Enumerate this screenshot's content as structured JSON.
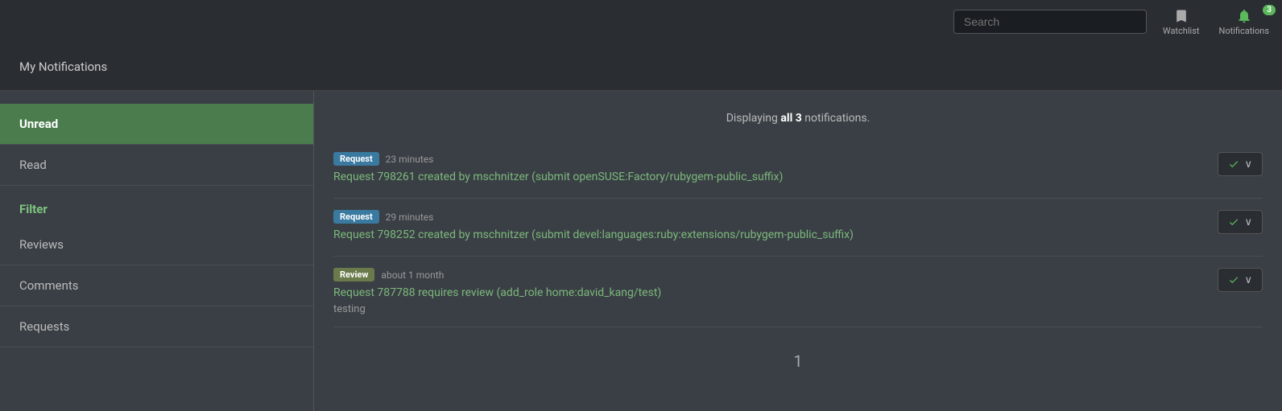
{
  "topnav": {
    "search_placeholder": "Search",
    "watchlist_label": "Watchlist",
    "notifications_label": "Notifications",
    "notifications_count": "3"
  },
  "page_header": {
    "title": "My Notifications"
  },
  "sidebar": {
    "nav_items": [
      {
        "id": "unread",
        "label": "Unread",
        "active": true
      },
      {
        "id": "read",
        "label": "Read",
        "active": false
      }
    ],
    "filter_label": "Filter",
    "filter_items": [
      {
        "id": "reviews",
        "label": "Reviews"
      },
      {
        "id": "comments",
        "label": "Comments"
      },
      {
        "id": "requests",
        "label": "Requests"
      }
    ]
  },
  "content": {
    "displaying_prefix": "Displaying ",
    "displaying_bold": "all 3",
    "displaying_suffix": " notifications.",
    "notifications": [
      {
        "id": "n1",
        "tag": "Request",
        "tag_type": "request",
        "time": "23 minutes",
        "link": "Request 798261 created by mschnitzer (submit openSUSE:Factory/rubygem-public_suffix)",
        "sub": ""
      },
      {
        "id": "n2",
        "tag": "Request",
        "tag_type": "request",
        "time": "29 minutes",
        "link": "Request 798252 created by mschnitzer (submit devel:languages:ruby:extensions/rubygem-public_suffix)",
        "sub": ""
      },
      {
        "id": "n3",
        "tag": "Review",
        "tag_type": "review",
        "time": "about 1 month",
        "link": "Request 787788 requires review (add_role home:david_kang/test)",
        "sub": "testing"
      }
    ],
    "action_button_label": "✓ ∨"
  }
}
